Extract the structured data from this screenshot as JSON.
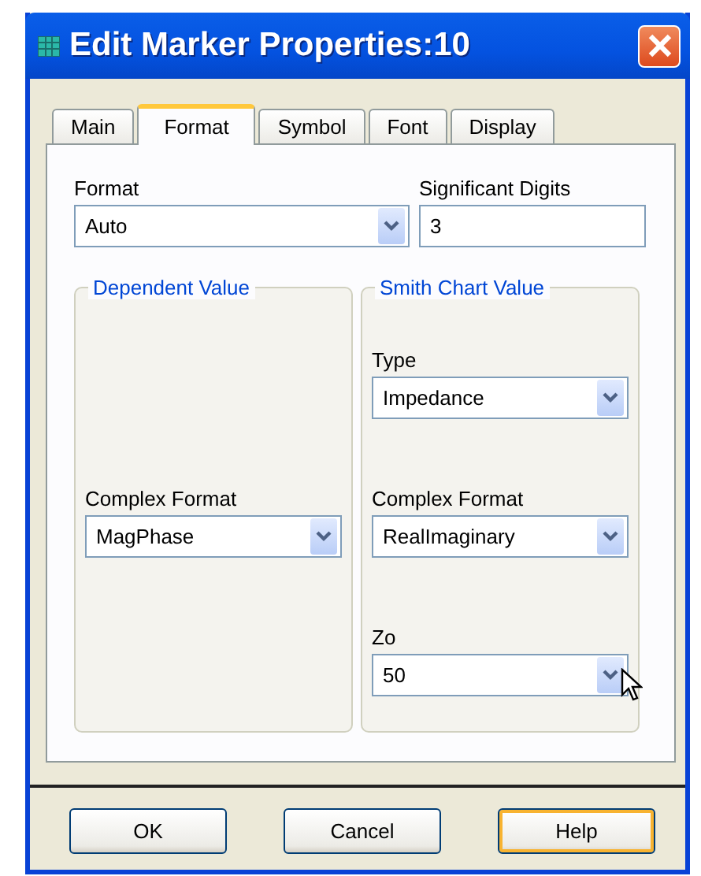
{
  "window": {
    "title": "Edit Marker Properties:10"
  },
  "tabs": [
    {
      "label": "Main",
      "selected": false
    },
    {
      "label": "Format",
      "selected": true
    },
    {
      "label": "Symbol",
      "selected": false
    },
    {
      "label": "Font",
      "selected": false
    },
    {
      "label": "Display",
      "selected": false
    }
  ],
  "format": {
    "label": "Format",
    "value": "Auto"
  },
  "significant_digits": {
    "label": "Significant Digits",
    "value": "3"
  },
  "groups": [
    {
      "title": "Dependent Value",
      "fields": [
        {
          "label": "Complex Format",
          "value": "MagPhase"
        }
      ]
    },
    {
      "title": "Smith Chart Value",
      "fields": [
        {
          "label": "Type",
          "value": "Impedance"
        },
        {
          "label": "Complex Format",
          "value": "RealImaginary"
        },
        {
          "label": "Zo",
          "value": "50"
        }
      ]
    }
  ],
  "buttons": [
    {
      "label": "OK",
      "focused": false
    },
    {
      "label": "Cancel",
      "focused": false
    },
    {
      "label": "Help",
      "focused": true
    }
  ]
}
